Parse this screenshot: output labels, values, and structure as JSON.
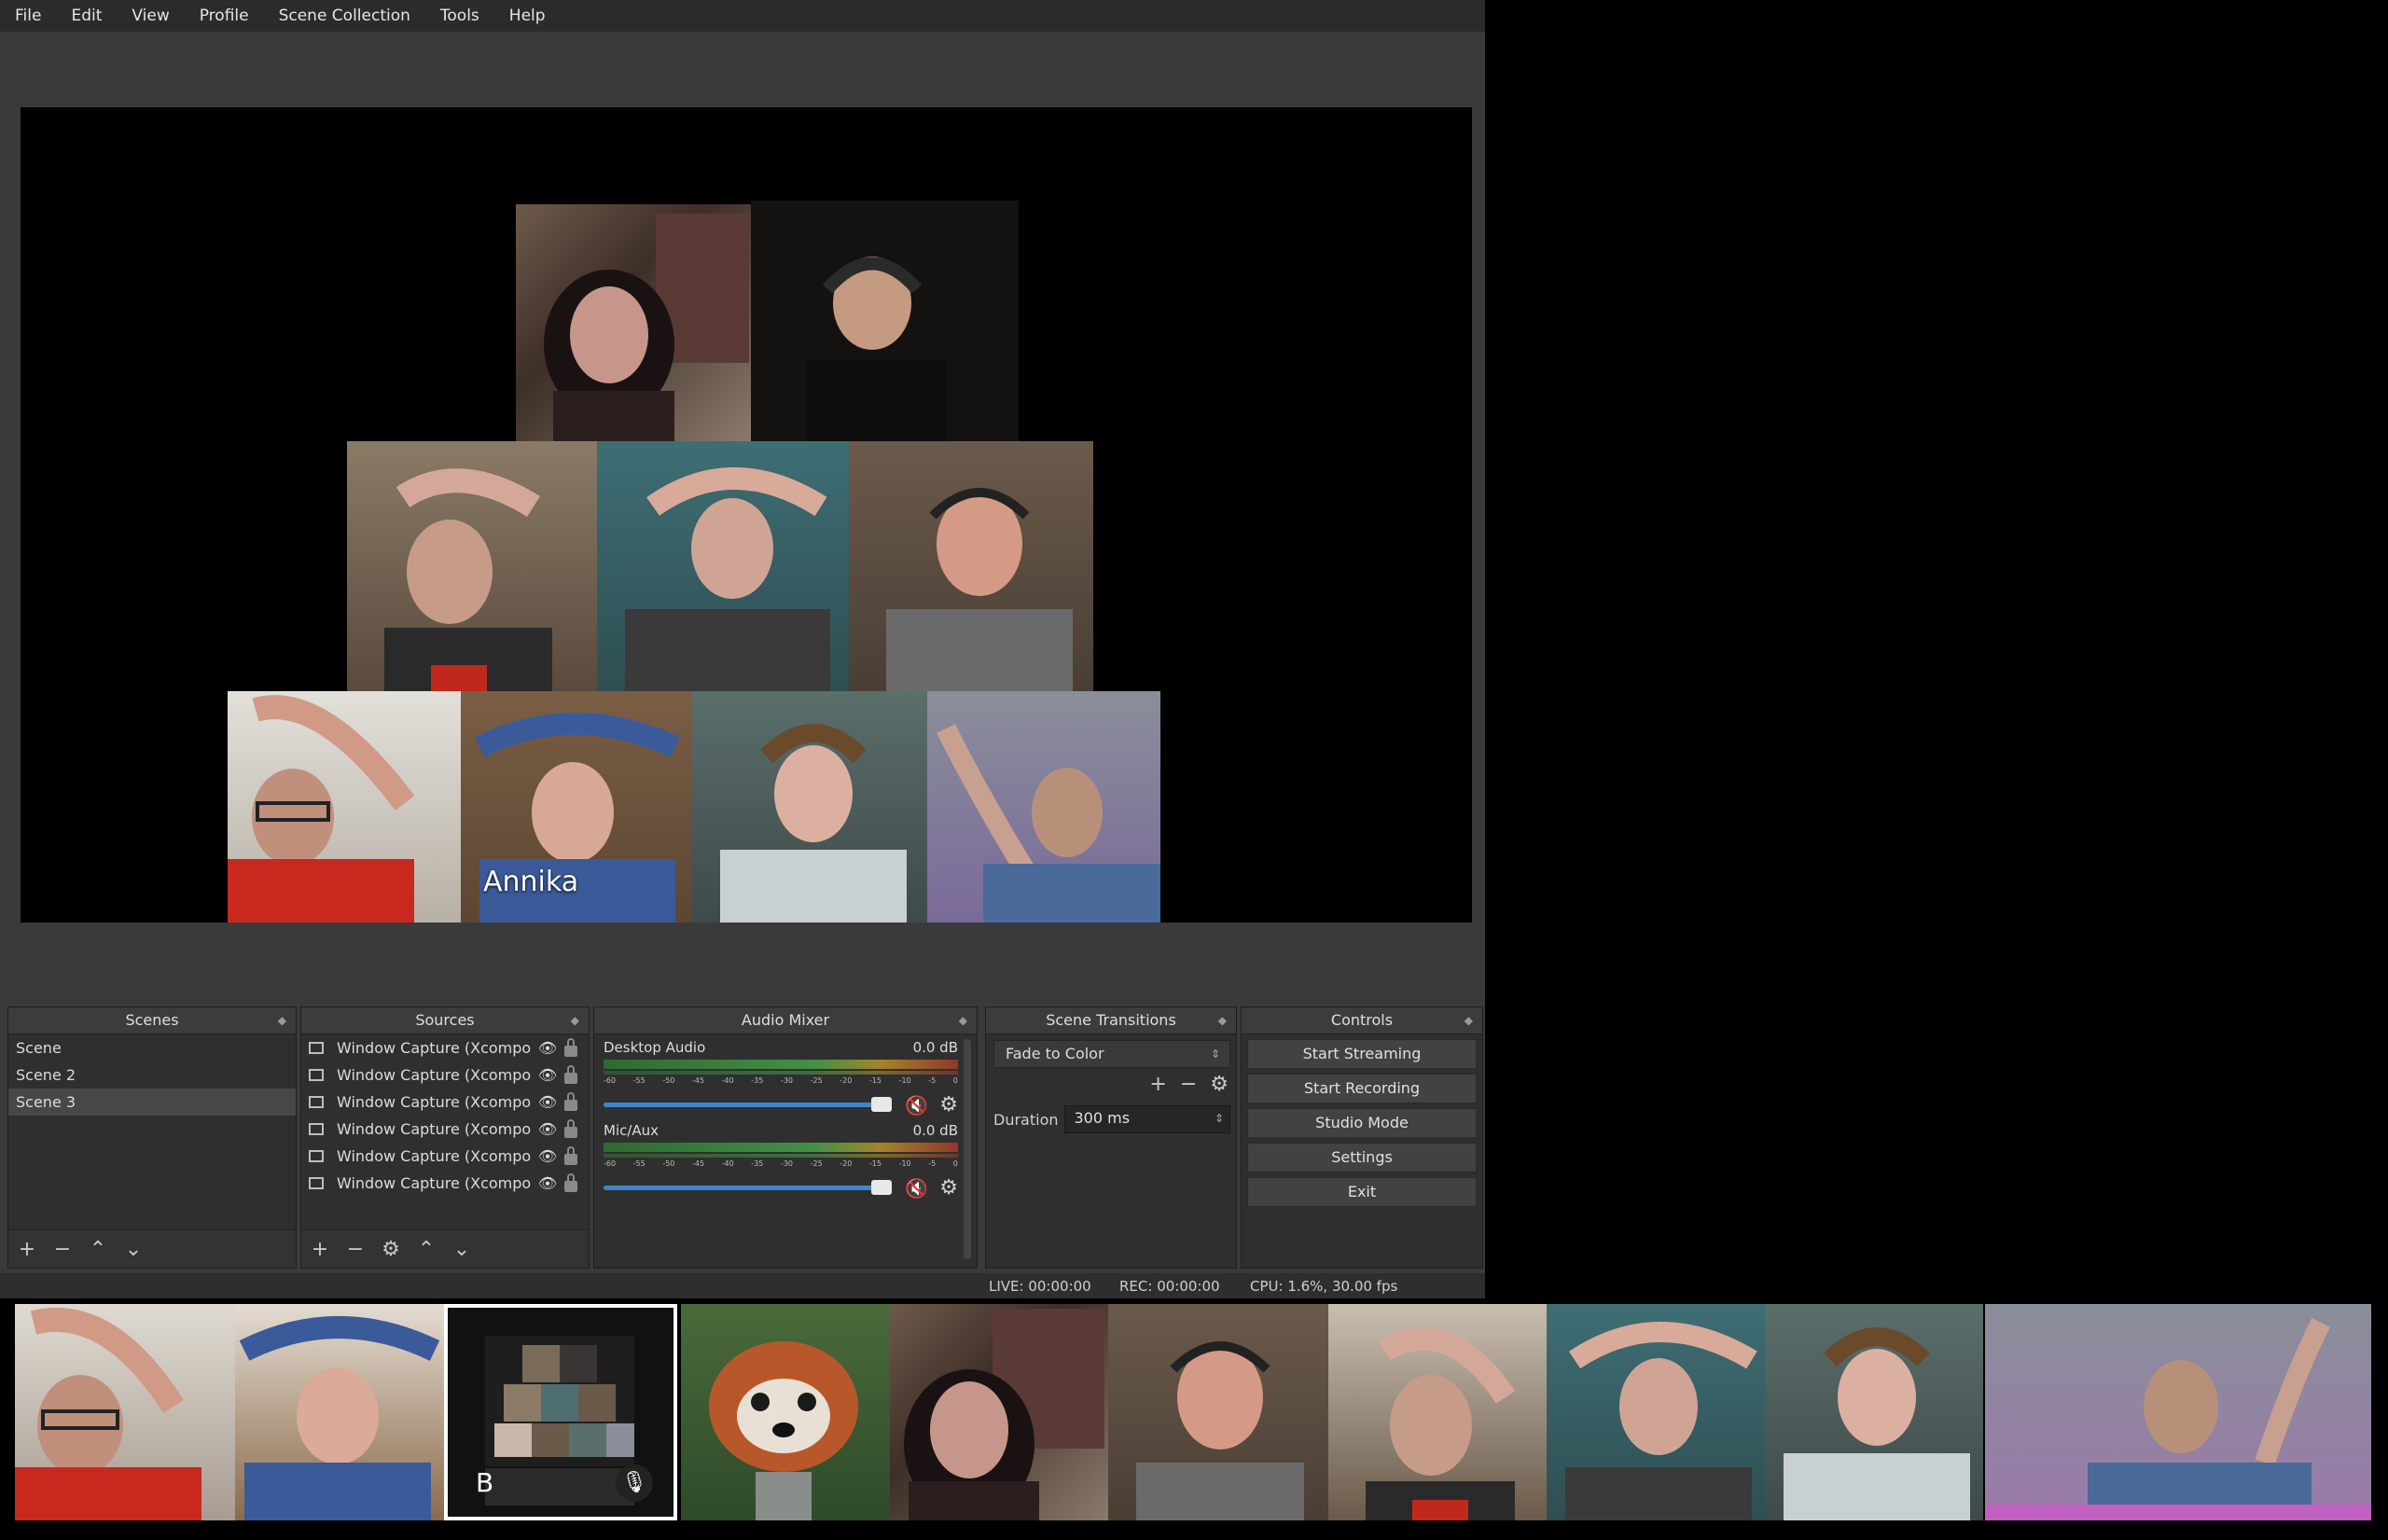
{
  "menu": [
    "File",
    "Edit",
    "View",
    "Profile",
    "Scene Collection",
    "Tools",
    "Help"
  ],
  "preview": {
    "tiles": [
      {
        "name": "girl-long-hair-bookshelf",
        "label": ""
      },
      {
        "name": "boy-headset-dark",
        "label": ""
      },
      {
        "name": "girl-arms-up-red-top",
        "label": ""
      },
      {
        "name": "girl-grey-hoodie-arms-up",
        "label": ""
      },
      {
        "name": "man-headset",
        "label": ""
      },
      {
        "name": "boy-glasses-red-shirt",
        "label": ""
      },
      {
        "name": "woman-blue-hoodie",
        "label": "Annika"
      },
      {
        "name": "boy-earphones-waving",
        "label": ""
      },
      {
        "name": "man-waving-purple",
        "label": ""
      }
    ]
  },
  "scenes": {
    "title": "Scenes",
    "items": [
      "Scene",
      "Scene 2",
      "Scene 3"
    ],
    "selected_index": 2
  },
  "sources": {
    "title": "Sources",
    "items": [
      "Window Capture (Xcompo",
      "Window Capture (Xcompo",
      "Window Capture (Xcompo",
      "Window Capture (Xcompo",
      "Window Capture (Xcompo",
      "Window Capture (Xcompo"
    ]
  },
  "mixer": {
    "title": "Audio Mixer",
    "ticks": [
      "-60",
      "-55",
      "-50",
      "-45",
      "-40",
      "-35",
      "-30",
      "-25",
      "-20",
      "-15",
      "-10",
      "-5",
      "0"
    ],
    "channels": [
      {
        "name": "Desktop Audio",
        "level": "0.0 dB",
        "volume": 0.95,
        "muted": true
      },
      {
        "name": "Mic/Aux",
        "level": "0.0 dB",
        "volume": 0.95,
        "muted": true
      }
    ]
  },
  "transitions": {
    "title": "Scene Transitions",
    "selected": "Fade to Color",
    "duration_label": "Duration",
    "duration_value": "300 ms"
  },
  "controls": {
    "title": "Controls",
    "buttons": [
      "Start Streaming",
      "Start Recording",
      "Studio Mode",
      "Settings",
      "Exit"
    ]
  },
  "status": {
    "live": "LIVE: 00:00:00",
    "rec": "REC: 00:00:00",
    "cpu": "CPU: 1.6%, 30.00 fps"
  },
  "strip": {
    "thumbs": [
      {
        "name": "boy-glasses-arms-up"
      },
      {
        "name": "woman-blue-hoodie-arms-up"
      },
      {
        "name": "self-view-obs",
        "initial": "B",
        "muted": true
      },
      {
        "name": "red-panda"
      },
      {
        "name": "girl-long-hair"
      },
      {
        "name": "man-headset"
      },
      {
        "name": "girl-red-top-waving"
      },
      {
        "name": "girl-grey-hoodie-waving"
      },
      {
        "name": "boy-earphones-waving"
      },
      {
        "name": "man-waving"
      }
    ]
  }
}
